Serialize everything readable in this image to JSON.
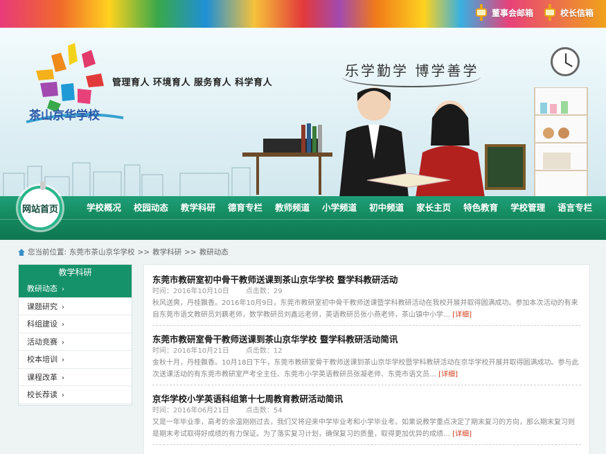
{
  "top_links": [
    {
      "label": "董事会邮箱",
      "icon": "mailbox-icon"
    },
    {
      "label": "校长信箱",
      "icon": "mailbox-icon"
    }
  ],
  "header": {
    "school_name": "茶山京华学校",
    "slogan": "管理育人 环境育人 服务育人 科学育人",
    "calligraphy": "乐学勤学  博学善学"
  },
  "nav": {
    "home": "网站首页",
    "items": [
      "学校概况",
      "校园动态",
      "教学科研",
      "德育专栏",
      "教师频道",
      "小学频道",
      "初中频道",
      "家长主页",
      "特色教育",
      "学校管理",
      "语言专栏"
    ]
  },
  "breadcrumb": {
    "prefix": "您当前位置:",
    "trail": [
      "东莞市茶山京华学校",
      ">>",
      "教学科研",
      ">>",
      "教研动态"
    ]
  },
  "sidebar": {
    "title": "教学科研",
    "items": [
      "教研动态",
      "课题研究",
      "科组建设",
      "活动竞赛",
      "校本培训",
      "课程改革",
      "校长荐读"
    ],
    "active_index": 0
  },
  "articles": [
    {
      "title": "东莞市教研室初中骨干教师送课到茶山京华学校 暨学科教研活动",
      "time_label": "时间：",
      "time": "2016年10月10日",
      "clicks_label": "点击数：",
      "clicks": "29",
      "summary": "秋风送爽，丹桂飘香。2016年10月9日，东莞市教研室初中骨干教师送课暨学科教研活动在我校开展并取得圆满成功。参加本次活动的有来自东莞市语文教研员刘藕老师，数学教研员刘鑫远老师，英语教研员张小燕老师，茶山镇中小学…",
      "more": "[详细]"
    },
    {
      "title": "东莞市教研室骨干教师送课到茶山京华学校 暨学科教研活动简讯",
      "time_label": "时间：",
      "time": "2016年10月21日",
      "clicks_label": "点击数：",
      "clicks": "12",
      "summary": "金秋十月，丹桂飘香。10月18日下午，东莞市教研室骨干教师送课到茶山京华学校暨学科教研活动在京华学校开展并取得圆满成功。参与此次送课活动的有东莞市教研室严考全主任、东莞市小学英语教研员张凝老师、东莞市语文员…",
      "more": "[详细]"
    },
    {
      "title": "京华学校小学英语科组第十七周教育教研活动简讯",
      "time_label": "时间：",
      "time": "2016年06月21日",
      "clicks_label": "点击数：",
      "clicks": "54",
      "summary": "又是一年毕业季，高考的余温刚刚过去，我们又将迎来中学毕业考和小学毕业考。如果说教学重点决定了期末复习的方向，那么期末复习则是期末考试取得好成绩的有力保证。为了落实复习计划，确保复习的质量，取得更加优异的成绩…",
      "more": "[详细]"
    }
  ],
  "colors": {
    "nav_green": "#15926a",
    "more_red": "#d03a1a",
    "school_blue": "#2c5aa8"
  }
}
